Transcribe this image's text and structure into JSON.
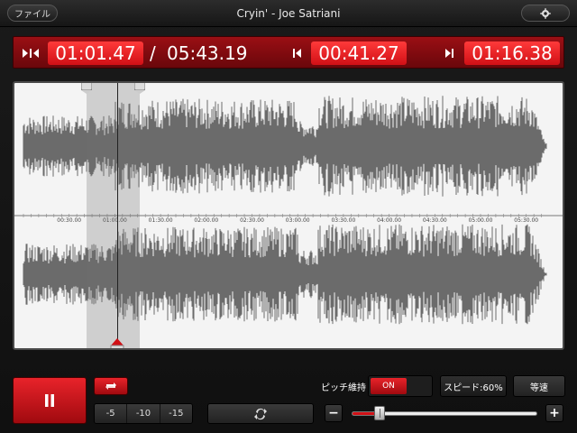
{
  "header": {
    "file_label": "ファイル",
    "title": "Cryin' - Joe Satriani",
    "settings_icon": "gear-icon"
  },
  "times": {
    "current": "01:01.47",
    "separator": "/",
    "total": "05:43.19",
    "loop_start": "00:41.27",
    "loop_end": "01:16.38",
    "icons": [
      "jump-to-playhead-icon",
      "loop-start-icon",
      "loop-end-icon"
    ]
  },
  "waveform": {
    "tick_labels": [
      "00:30.00",
      "01:00.00",
      "01:30.00",
      "02:00.00",
      "02:30.00",
      "03:00.00",
      "03:30.00",
      "04:00.00",
      "04:30.00",
      "05:00.00",
      "05:30.00"
    ],
    "tick_seconds": [
      30,
      60,
      90,
      120,
      150,
      180,
      210,
      240,
      270,
      300,
      330
    ],
    "duration_seconds": 343.19,
    "playhead_seconds": 61.47,
    "selection_start_seconds": 41.27,
    "selection_end_seconds": 76.38,
    "wave_color": "#6b6b6b",
    "selection_color": "#b0b0b0"
  },
  "controls": {
    "pause_icon": "pause-icon",
    "loop_icon": "loop-icon",
    "skip_buttons": [
      "-5",
      "-10",
      "-15"
    ],
    "reset_icon": "loop-reset-icon",
    "pitch_label": "ピッチ維持",
    "pitch_state": "ON",
    "speed_label": "スピード:60%",
    "normal_speed_label": "等速",
    "minus_label": "−",
    "plus_label": "+",
    "speed_value": 0.15
  },
  "colors": {
    "accent": "#d11016",
    "accent_light": "#ff3a3a",
    "background": "#151515"
  }
}
